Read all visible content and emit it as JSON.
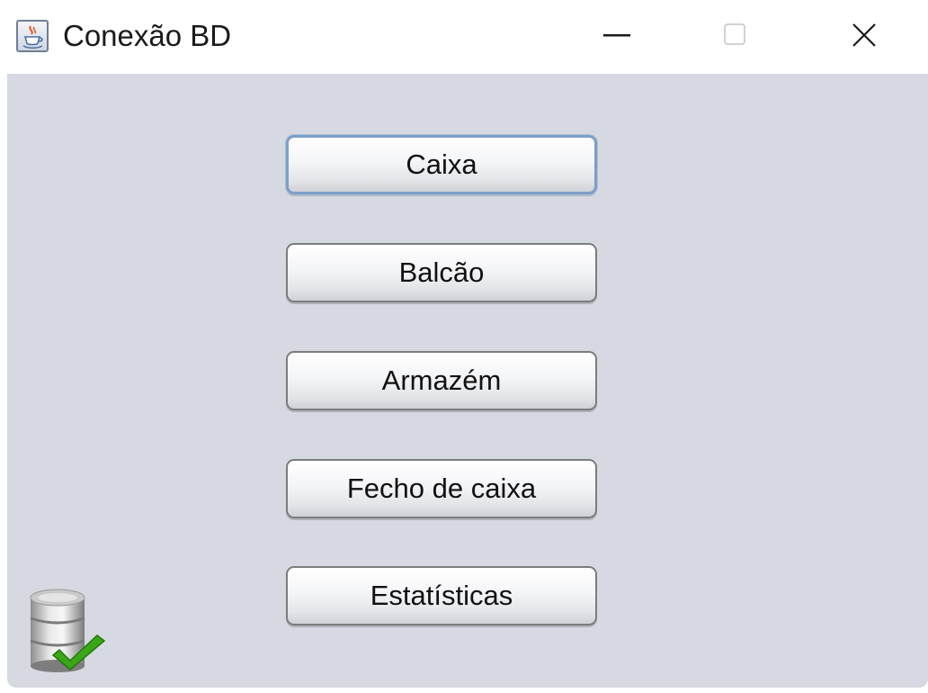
{
  "window": {
    "title": "Conexão BD",
    "icon": "java-cup-icon",
    "controls": {
      "minimize": "minimize-icon",
      "maximize": "maximize-icon",
      "close": "close-icon"
    }
  },
  "menu": {
    "buttons": [
      {
        "label": "Caixa",
        "focused": true
      },
      {
        "label": "Balcão"
      },
      {
        "label": "Armazém"
      },
      {
        "label": "Fecho de caixa"
      },
      {
        "label": "Estatísticas"
      }
    ]
  },
  "status": {
    "connection_icon": "database-connected-icon"
  },
  "colors": {
    "content_background": "#d6d9e1",
    "focus_border": "#7d9fc5",
    "check_green": "#3aa617"
  }
}
